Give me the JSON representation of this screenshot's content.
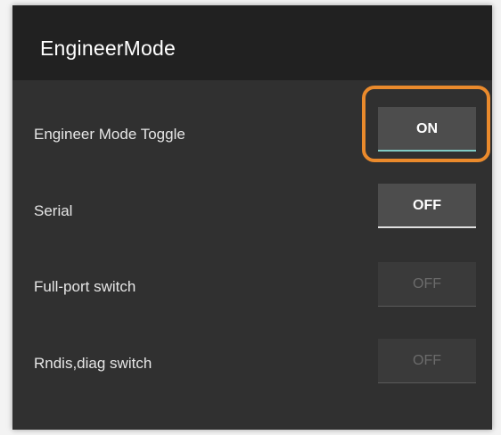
{
  "app_bar": {
    "title": "EngineerMode"
  },
  "settings": [
    {
      "label": "Engineer Mode Toggle",
      "toggle": "ON",
      "state": "on",
      "enabled": true
    },
    {
      "label": "Serial",
      "toggle": "OFF",
      "state": "off",
      "enabled": true
    },
    {
      "label": "Full-port switch",
      "toggle": "OFF",
      "state": "off",
      "enabled": false
    },
    {
      "label": "Rndis,diag switch",
      "toggle": "OFF",
      "state": "off",
      "enabled": false
    }
  ],
  "colors": {
    "background": "#303030",
    "app_bar": "#212121",
    "accent_on": "#7fcbc4",
    "highlight": "#ea8a2c"
  }
}
